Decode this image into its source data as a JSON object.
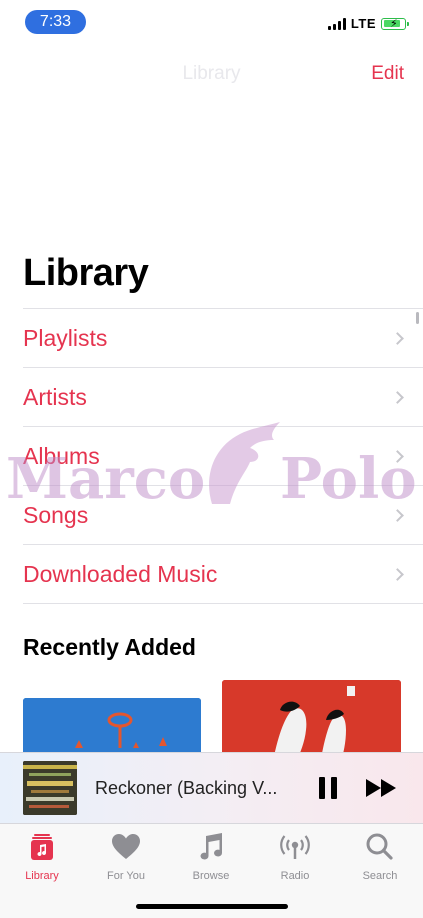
{
  "status_bar": {
    "time": "7:33",
    "network": "LTE"
  },
  "nav": {
    "title": "Library",
    "edit_label": "Edit"
  },
  "page_title": "Library",
  "library_items": [
    {
      "label": "Playlists"
    },
    {
      "label": "Artists"
    },
    {
      "label": "Albums"
    },
    {
      "label": "Songs"
    },
    {
      "label": "Downloaded Music"
    }
  ],
  "recently_added": {
    "title": "Recently Added"
  },
  "watermark": {
    "left": "Marco",
    "right": "Polo"
  },
  "now_playing": {
    "title": "Reckoner (Backing V..."
  },
  "tabs": [
    {
      "label": "Library",
      "icon": "library-icon",
      "active": true
    },
    {
      "label": "For You",
      "icon": "heart-icon",
      "active": false
    },
    {
      "label": "Browse",
      "icon": "music-note-icon",
      "active": false
    },
    {
      "label": "Radio",
      "icon": "radio-icon",
      "active": false
    },
    {
      "label": "Search",
      "icon": "search-icon",
      "active": false
    }
  ],
  "colors": {
    "accent": "#e5344f",
    "time_pill": "#2f6fe0",
    "battery": "#4cd964"
  }
}
